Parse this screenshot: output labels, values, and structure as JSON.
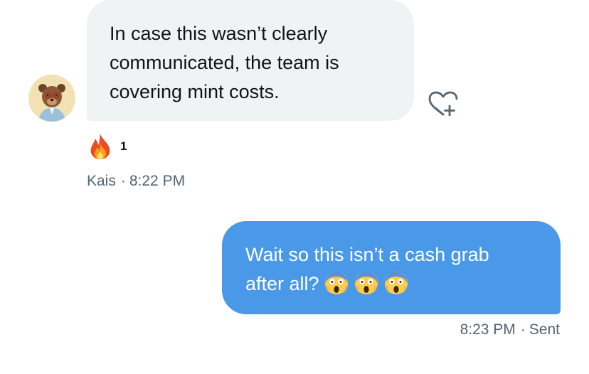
{
  "incoming_message": {
    "text": "In case this wasn’t clearly\ncommunicated, the team is\ncovering mint costs.",
    "sender": "Kais",
    "time": "8:22 PM",
    "avatar_icon": "bear-avatar-icon",
    "bubble_color": "#eff3f4",
    "reaction": {
      "emoji_icon": "fire-emoji-icon",
      "count": "1"
    },
    "add_reaction_icon": "heart-plus-icon"
  },
  "outgoing_message": {
    "line1": "Wait so this isn’t a cash grab",
    "line2": "after all?",
    "emoji_icon": "screaming-face-emoji-icon",
    "emoji_count": 3,
    "time": "8:23 PM",
    "status": "Sent",
    "bubble_color": "#4a99e9"
  },
  "separator": "·"
}
